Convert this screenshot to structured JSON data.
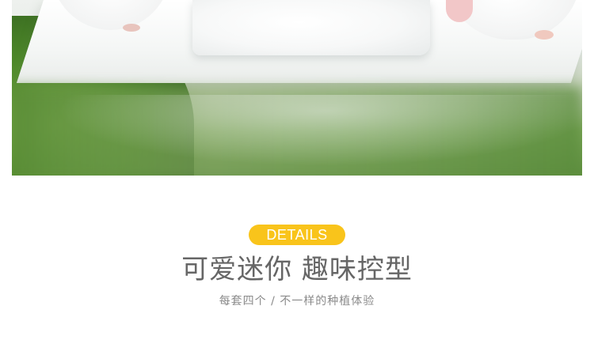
{
  "photo": {
    "alt_subject": "mini succulent planters with moss"
  },
  "details": {
    "badge_label": "DETAILS",
    "badge_color": "#f9c41b",
    "headline": "可爱迷你 趣味控型",
    "subline": "每套四个 / 不一样的种植体验"
  }
}
